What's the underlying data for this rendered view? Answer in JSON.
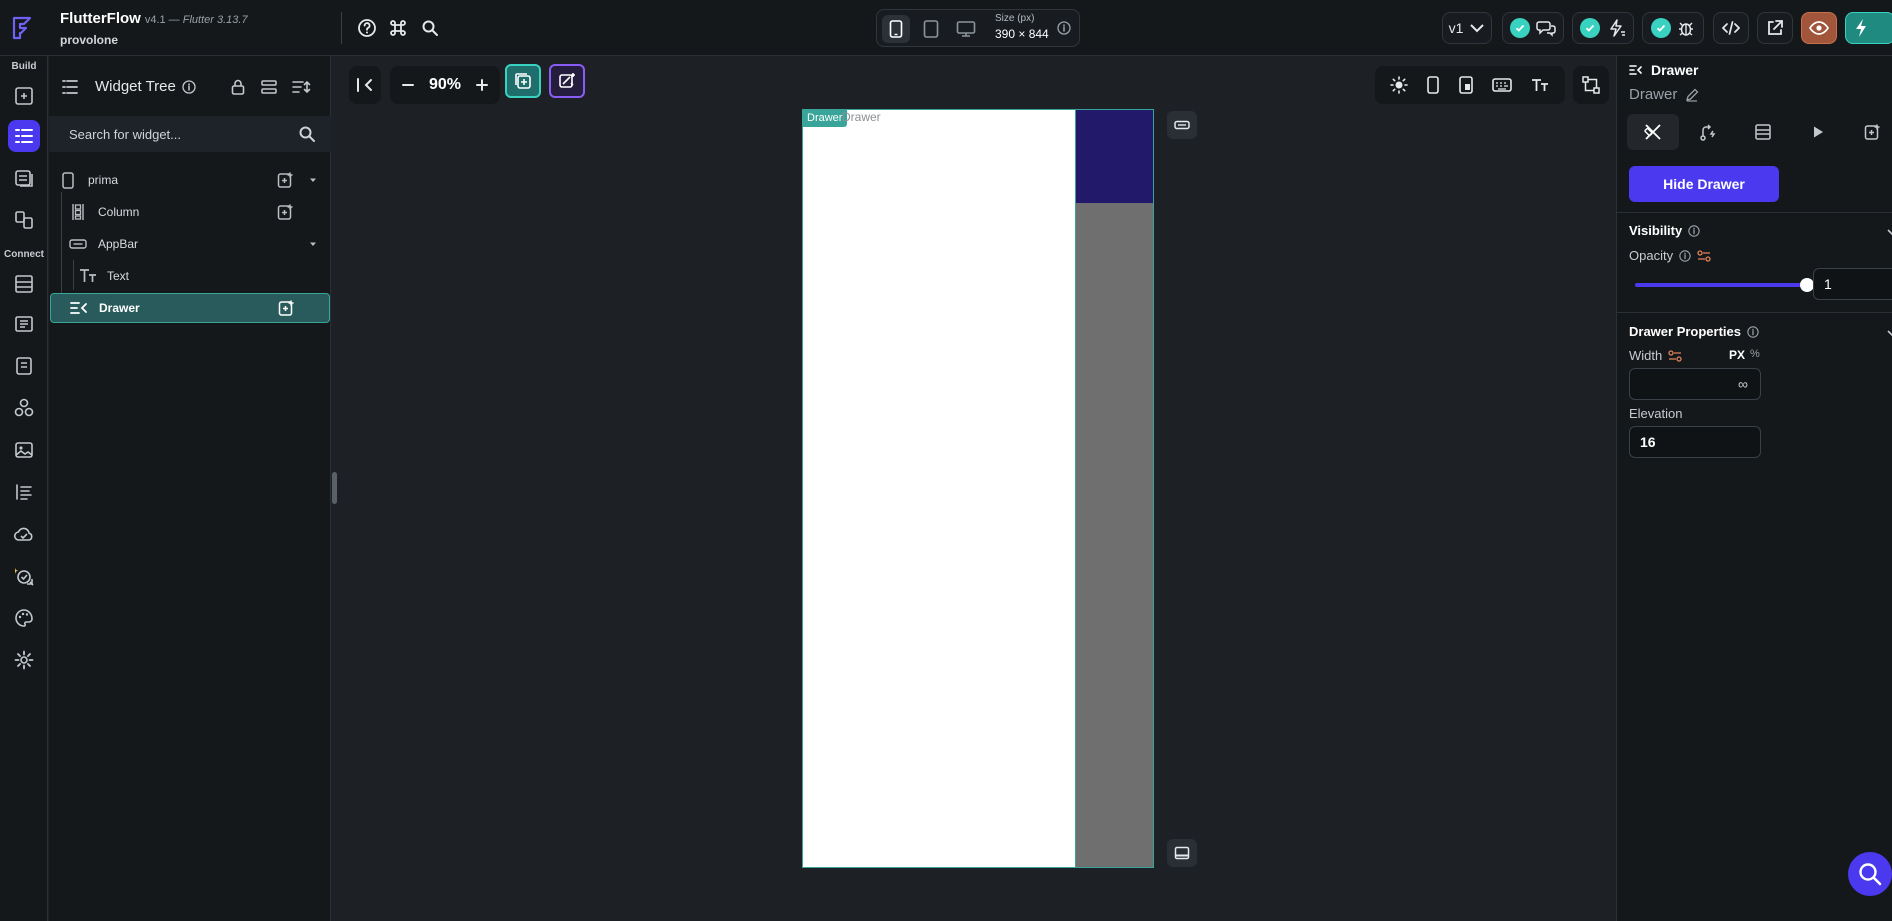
{
  "app": {
    "name": "FlutterFlow",
    "version": "v4.1 —",
    "flutter_version": "Flutter 3.13.7",
    "project": "provolone"
  },
  "topbar": {
    "size_label": "Size (px)",
    "size_value": "390 × 844",
    "version_select": "v1"
  },
  "rail": {
    "build_label": "Build",
    "connect_label": "Connect"
  },
  "widget_tree": {
    "title": "Widget Tree",
    "search_placeholder": "Search for widget...",
    "items": [
      {
        "label": "prima"
      },
      {
        "label": "Column"
      },
      {
        "label": "AppBar"
      },
      {
        "label": "Text"
      },
      {
        "label": "Drawer"
      }
    ]
  },
  "canvas": {
    "zoom": "90%",
    "drawer_badge": "Drawer",
    "drawer_ghost": "Drawer"
  },
  "properties": {
    "widget_type": "Drawer",
    "widget_name": "Drawer",
    "hide_button": "Hide Drawer",
    "visibility_title": "Visibility",
    "opacity_label": "Opacity",
    "opacity_value": "1",
    "opacity_fraction": 1,
    "drawer_props_title": "Drawer Properties",
    "width_label": "Width",
    "width_unit_px": "PX",
    "width_unit_pct": "%",
    "width_value": "∞",
    "elevation_label": "Elevation",
    "elevation_value": "16"
  },
  "colors": {
    "accent": "#4b39ef",
    "teal": "#39d2c0",
    "selection": "#2a5b5c",
    "appbar_preview": "#23196a"
  }
}
